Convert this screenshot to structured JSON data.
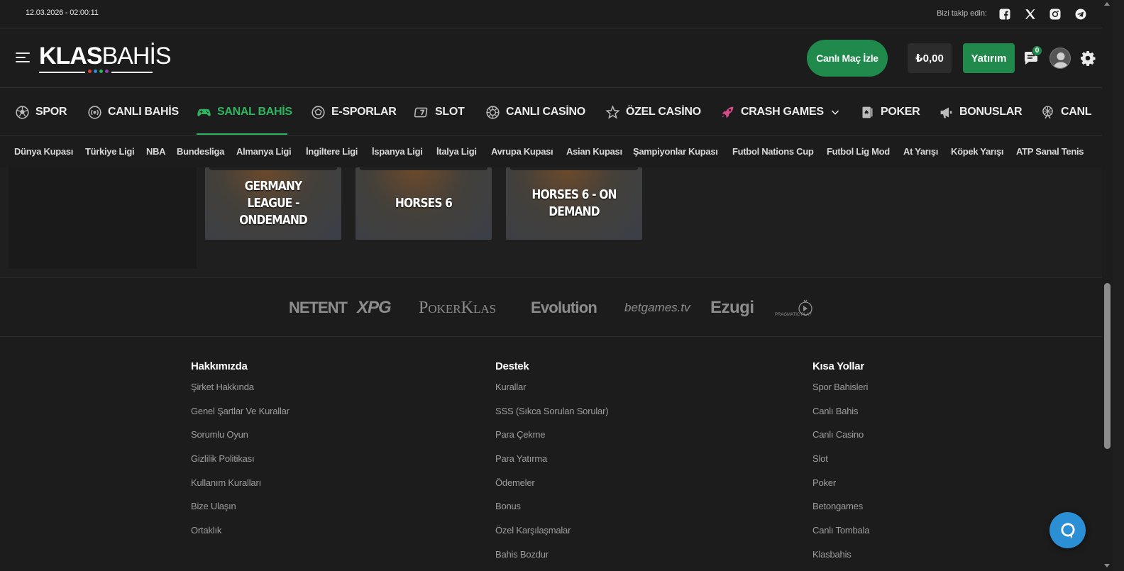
{
  "topbar": {
    "datetime": "12.03.2026 - 02:00:11",
    "follow_label": "Bizi takip edin:",
    "social": [
      "facebook-icon",
      "x-twitter-icon",
      "instagram-icon",
      "telegram-icon"
    ]
  },
  "header": {
    "logo_bold": "KLAS",
    "logo_light": "BAHİS",
    "logo_dot_colors": [
      "#e23b3b",
      "#2e8fd6",
      "#2eb55f",
      "#8e44ad"
    ],
    "live_button": "Canlı Maç İzle",
    "balance": "₺0,00",
    "deposit_button": "Yatırım",
    "chat_badge": "0",
    "accent_color": "#1f8a4c"
  },
  "mainnav": {
    "items": [
      {
        "label": "SPOR",
        "icon": "soccer-ball-icon"
      },
      {
        "label": "CANLI BAHİS",
        "icon": "live-broadcast-icon"
      },
      {
        "label": "SANAL BAHİS",
        "icon": "gamepad-icon",
        "active": true
      },
      {
        "label": "E-SPORLAR",
        "icon": "esports-icon"
      },
      {
        "label": "SLOT",
        "icon": "slot-seven-icon"
      },
      {
        "label": "CANLI CASİNO",
        "icon": "casino-chip-icon"
      },
      {
        "label": "ÖZEL CASİNO",
        "icon": "star-icon"
      },
      {
        "label": "CRASH GAMES",
        "icon": "rocket-icon"
      },
      {
        "label": "POKER",
        "icon": "playing-card-icon"
      },
      {
        "label": "BONUSLAR",
        "icon": "megaphone-icon"
      },
      {
        "label": "CANL",
        "icon": "ferris-wheel-icon"
      }
    ]
  },
  "subnav": {
    "items": [
      "Dünya Kupası",
      "Türkiye Ligi",
      "NBA",
      "Bundesliga",
      "Almanya Ligi",
      "İngiltere Ligi",
      "İspanya Ligi",
      "İtalya Ligi",
      "Avrupa Kupası",
      "Asian Kupası",
      "Şampiyonlar Kupası",
      "Futbol Nations Cup",
      "Futbol Lig Mod",
      "At Yarışı",
      "Köpek Yarışı",
      "ATP Sanal Tenis"
    ]
  },
  "games": [
    {
      "title": "GERMANY LEAGUE - ONDEMAND"
    },
    {
      "title": "HORSES 6"
    },
    {
      "title": "HORSES 6 - ON DEMAND"
    }
  ],
  "providers": [
    "NETENT",
    "XPG",
    "PokerKlas",
    "Evolution",
    "betgames.tv",
    "Ezugi",
    "PRAGMATIC PLAY"
  ],
  "footer": {
    "columns": [
      {
        "title": "Hakkımızda",
        "links": [
          "Şirket Hakkında",
          "Genel Şartlar Ve Kurallar",
          "Sorumlu Oyun",
          "Gizlilik Politikası",
          "Kullanım Kuralları",
          "Bize Ulaşın",
          "Ortaklık"
        ]
      },
      {
        "title": "Destek",
        "links": [
          "Kurallar",
          "SSS (Sıkca Sorulan Sorular)",
          "Para Çekme",
          "Para Yatırma",
          "Ödemeler",
          "Bonus",
          "Özel Karşılaşmalar",
          "Bahis Bozdur"
        ]
      },
      {
        "title": "Kısa Yollar",
        "links": [
          "Spor Bahisleri",
          "Canlı Bahis",
          "Canlı Casino",
          "Slot",
          "Poker",
          "Betongames",
          "Canlı Tombala",
          "Klasbahis"
        ]
      }
    ]
  }
}
